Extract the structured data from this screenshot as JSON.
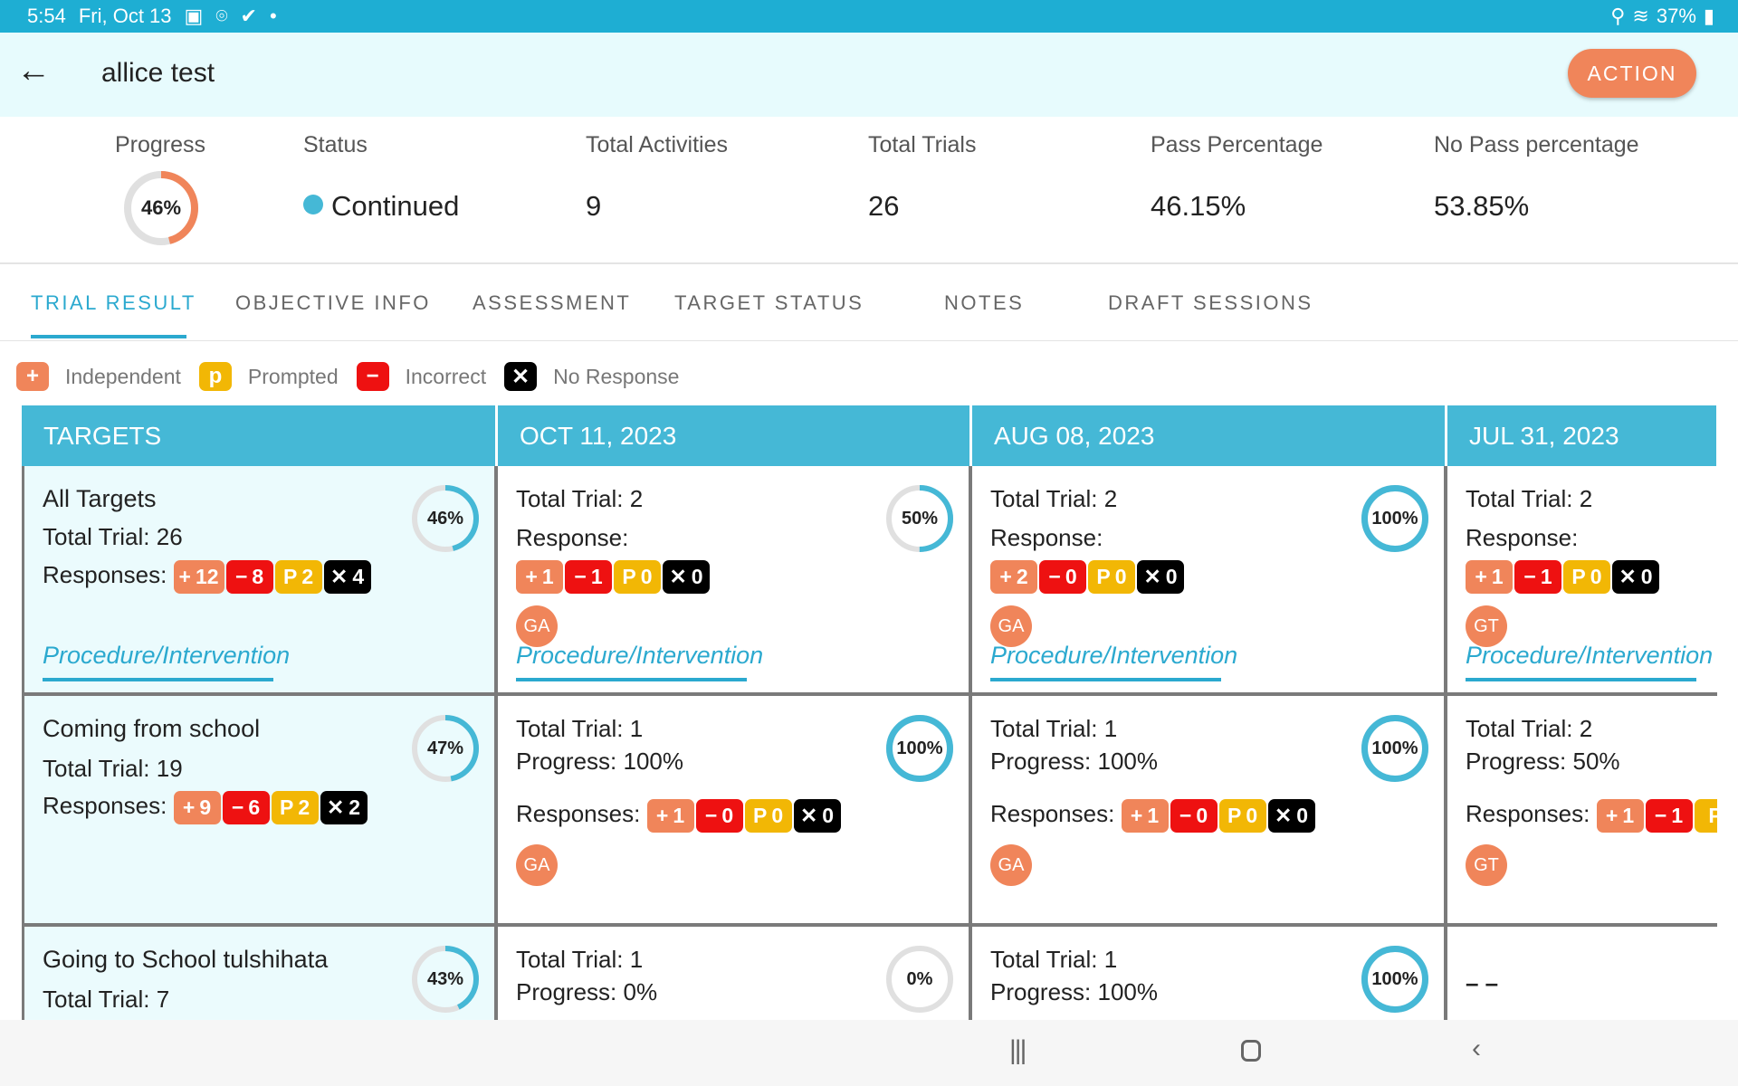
{
  "status_bar": {
    "time": "5:54",
    "date": "Fri, Oct 13",
    "battery": "37%",
    "icons": [
      "gallery-icon",
      "location-icon",
      "check-icon",
      "dot-icon",
      "location-icon",
      "wifi-icon",
      "battery-icon"
    ]
  },
  "header": {
    "title": "allice test",
    "action_label": "ACTION",
    "back_icon": "arrow-left-icon"
  },
  "stats": {
    "progress_label": "Progress",
    "progress_value": "46%",
    "progress_fraction": 0.46,
    "status_label": "Status",
    "status_value": "Continued",
    "status_color": "#45b8d6",
    "activities_label": "Total Activities",
    "activities_value": "9",
    "trials_label": "Total Trials",
    "trials_value": "26",
    "pass_label": "Pass Percentage",
    "pass_value": "46.15%",
    "nopass_label": "No Pass percentage",
    "nopass_value": "53.85%"
  },
  "tabs": [
    "TRIAL RESULT",
    "OBJECTIVE INFO",
    "ASSESSMENT",
    "TARGET STATUS",
    "NOTES",
    "DRAFT SESSIONS"
  ],
  "active_tab": 0,
  "legend": [
    {
      "symbol": "+",
      "label": "Independent",
      "color": "#f0855a"
    },
    {
      "symbol": "p",
      "label": "Prompted",
      "color": "#f2b705"
    },
    {
      "symbol": "−",
      "label": "Incorrect",
      "color": "#ee1111"
    },
    {
      "symbol": "✕",
      "label": "No Response",
      "color": "#000000"
    }
  ],
  "chip_symbols": {
    "independent": "+",
    "incorrect": "−",
    "prompted": "P",
    "no_response": "✕"
  },
  "colors": {
    "accent": "#45b8d6",
    "orange": "#f0855a",
    "ring_track": "#e0e0e0"
  },
  "table": {
    "headers": [
      "TARGETS",
      "OCT 11, 2023",
      "AUG 08, 2023",
      "JUL 31, 2023"
    ],
    "total_trial_label": "Total Trial:",
    "response_label": "Response:",
    "responses_label": "Responses:",
    "progress_label": "Progress:",
    "procedure_label": "Procedure/Intervention",
    "empty_text": "– –",
    "rows": [
      {
        "target": {
          "name": "All Targets",
          "total_trial": "26",
          "percent": "46%",
          "fraction": 0.46,
          "responses": [
            [
              "independent",
              "12"
            ],
            [
              "incorrect",
              "8"
            ],
            [
              "prompted",
              "2"
            ],
            [
              "no_response",
              "4"
            ]
          ]
        },
        "sessions": [
          {
            "total_trial": "2",
            "percent": "50%",
            "fraction": 0.5,
            "avatar": "GA",
            "responses": [
              [
                "independent",
                "1"
              ],
              [
                "incorrect",
                "1"
              ],
              [
                "prompted",
                "0"
              ],
              [
                "no_response",
                "0"
              ]
            ]
          },
          {
            "total_trial": "2",
            "percent": "100%",
            "fraction": 1,
            "avatar": "GA",
            "responses": [
              [
                "independent",
                "2"
              ],
              [
                "incorrect",
                "0"
              ],
              [
                "prompted",
                "0"
              ],
              [
                "no_response",
                "0"
              ]
            ]
          },
          {
            "total_trial": "2",
            "percent": "",
            "fraction": 0,
            "avatar": "GT",
            "responses": [
              [
                "independent",
                "1"
              ],
              [
                "incorrect",
                "1"
              ],
              [
                "prompted",
                "0"
              ],
              [
                "no_response",
                "0"
              ]
            ]
          }
        ]
      },
      {
        "target": {
          "name": "Coming from school",
          "total_trial": "19",
          "percent": "47%",
          "fraction": 0.47,
          "responses": [
            [
              "independent",
              "9"
            ],
            [
              "incorrect",
              "6"
            ],
            [
              "prompted",
              "2"
            ],
            [
              "no_response",
              "2"
            ]
          ]
        },
        "sessions": [
          {
            "total_trial": "1",
            "progress": "100%",
            "percent": "100%",
            "fraction": 1,
            "avatar": "GA",
            "responses": [
              [
                "independent",
                "1"
              ],
              [
                "incorrect",
                "0"
              ],
              [
                "prompted",
                "0"
              ],
              [
                "no_response",
                "0"
              ]
            ]
          },
          {
            "total_trial": "1",
            "progress": "100%",
            "percent": "100%",
            "fraction": 1,
            "avatar": "GA",
            "responses": [
              [
                "independent",
                "1"
              ],
              [
                "incorrect",
                "0"
              ],
              [
                "prompted",
                "0"
              ],
              [
                "no_response",
                "0"
              ]
            ]
          },
          {
            "total_trial": "2",
            "progress": "50%",
            "percent": "",
            "fraction": 0,
            "avatar": "GT",
            "responses": [
              [
                "independent",
                "1"
              ],
              [
                "incorrect",
                "1"
              ],
              [
                "prompted",
                ""
              ]
            ]
          }
        ]
      },
      {
        "target": {
          "name": "Going to School tulshihata",
          "total_trial": "7",
          "percent": "43%",
          "fraction": 0.43,
          "responses": []
        },
        "sessions": [
          {
            "total_trial": "1",
            "progress": "0%",
            "percent": "0%",
            "fraction": 0
          },
          {
            "total_trial": "1",
            "progress": "100%",
            "percent": "100%",
            "fraction": 1
          },
          {
            "empty": true
          }
        ]
      }
    ]
  }
}
